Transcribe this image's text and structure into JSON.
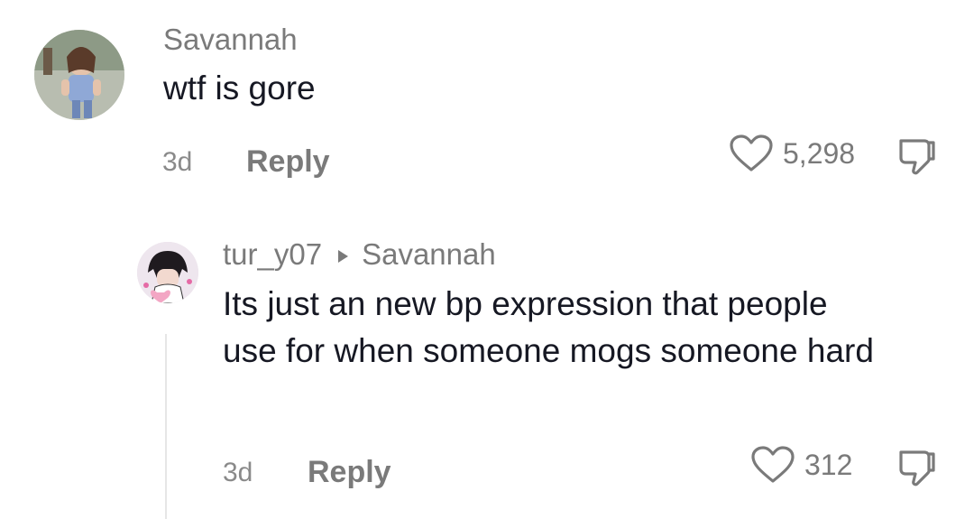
{
  "comments": [
    {
      "username": "Savannah",
      "text": "wtf is gore",
      "time": "3d",
      "reply_label": "Reply",
      "likes": "5,298",
      "avatar_icon": "user-avatar-photo"
    }
  ],
  "replies": [
    {
      "username": "tur_y07",
      "reply_to": "Savannah",
      "text": "Its just an new bp expression that people use for when someone mogs someone hard",
      "time": "3d",
      "reply_label": "Reply",
      "likes": "312",
      "avatar_icon": "anime-avatar"
    }
  ],
  "icons": {
    "like": "heart-outline-icon",
    "dislike": "thumbs-down-icon",
    "reply_to": "triangle-right-icon"
  },
  "colors": {
    "text": "#161823",
    "secondary": "#7a7a7a",
    "thread_line": "#e6e6e6"
  }
}
